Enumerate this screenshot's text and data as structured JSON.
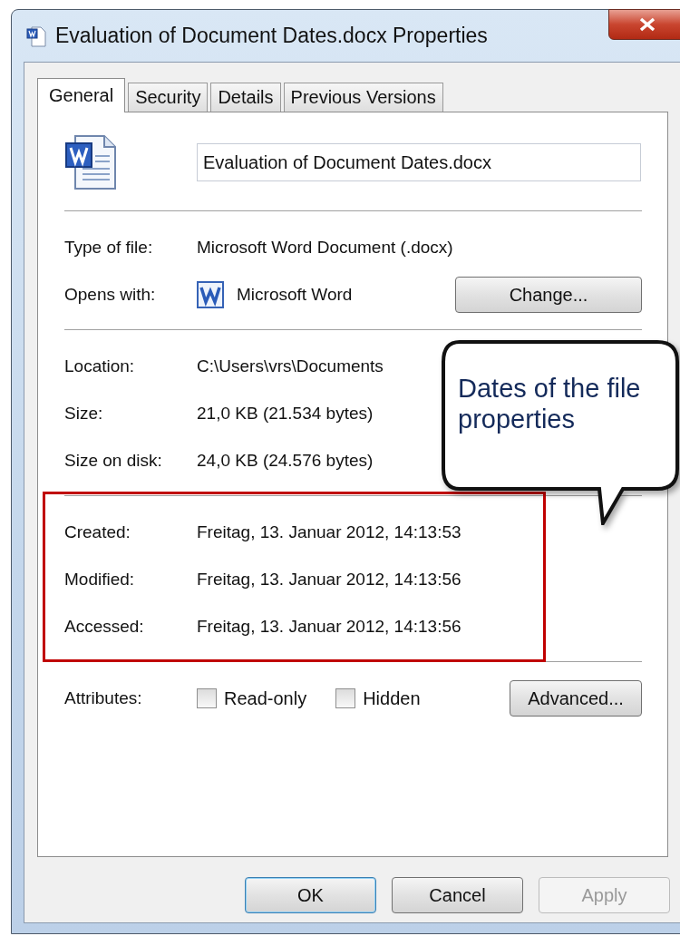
{
  "window": {
    "title": "Evaluation of Document Dates.docx Properties"
  },
  "tabs": [
    {
      "label": "General",
      "selected": true
    },
    {
      "label": "Security",
      "selected": false
    },
    {
      "label": "Details",
      "selected": false
    },
    {
      "label": "Previous Versions",
      "selected": false
    }
  ],
  "file_name": {
    "value": "Evaluation of Document Dates.docx"
  },
  "type_of_file": {
    "label": "Type of file:",
    "value": "Microsoft Word Document (.docx)"
  },
  "opens_with": {
    "label": "Opens with:",
    "value": "Microsoft Word",
    "button": "Change..."
  },
  "location_rows": [
    {
      "label": "Location:",
      "value": "C:\\Users\\vrs\\Documents"
    },
    {
      "label": "Size:",
      "value": "21,0 KB (21.534 bytes)"
    },
    {
      "label": "Size on disk:",
      "value": "24,0 KB (24.576 bytes)"
    }
  ],
  "date_rows": [
    {
      "label": "Created:",
      "value": "Freitag, 13. Januar 2012, 14:13:53"
    },
    {
      "label": "Modified:",
      "value": "Freitag, 13. Januar 2012, 14:13:56"
    },
    {
      "label": "Accessed:",
      "value": "Freitag, 13. Januar 2012, 14:13:56"
    }
  ],
  "attributes": {
    "label": "Attributes:",
    "checkboxes": [
      {
        "label": "Read-only",
        "checked": false
      },
      {
        "label": "Hidden",
        "checked": false
      }
    ],
    "button": "Advanced..."
  },
  "buttons": [
    {
      "label": "OK",
      "default": true,
      "disabled": false
    },
    {
      "label": "Cancel",
      "default": false,
      "disabled": false
    },
    {
      "label": "Apply",
      "default": false,
      "disabled": true
    }
  ],
  "callout": {
    "text": "Dates of the file properties"
  }
}
